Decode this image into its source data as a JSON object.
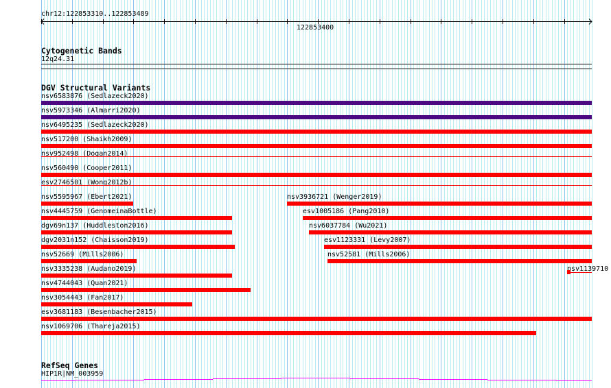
{
  "view": {
    "chrom": "chr12",
    "start": 122853310,
    "end": 122853489
  },
  "ruler": {
    "location_label": "chr12:122853310..122853489",
    "tick_label": "122853400",
    "tick_value": 122853400
  },
  "cytoband_track": {
    "title": "Cytogenetic Bands",
    "band": "12q24.31"
  },
  "dgv_track": {
    "title": "DGV Structural Variants",
    "colors": {
      "purple": "#4b0a82",
      "red": "#ff0000"
    },
    "rows": [
      [
        {
          "label": "nsv6583876 (Sedlazeck2020)",
          "start": 122853310,
          "end": 122853489,
          "color": "purple",
          "style": "thick"
        }
      ],
      [
        {
          "label": "nsv5973346 (Almarri2020)",
          "start": 122853310,
          "end": 122853489,
          "color": "purple",
          "style": "thick"
        }
      ],
      [
        {
          "label": "nsv6495235 (Sedlazeck2020)",
          "start": 122853310,
          "end": 122853489,
          "color": "red",
          "style": "thick"
        }
      ],
      [
        {
          "label": "nsv517200 (Shaikh2009)",
          "start": 122853310,
          "end": 122853489,
          "color": "red",
          "style": "thick"
        }
      ],
      [
        {
          "label": "nsv952498 (Dogan2014)",
          "start": 122853310,
          "end": 122853489,
          "color": "red",
          "style": "thin"
        }
      ],
      [
        {
          "label": "nsv560490 (Cooper2011)",
          "start": 122853310,
          "end": 122853489,
          "color": "red",
          "style": "thick"
        }
      ],
      [
        {
          "label": "esv2746501 (Wong2012b)",
          "start": 122853310,
          "end": 122853489,
          "color": "red",
          "style": "thin"
        }
      ],
      [
        {
          "label": "nsv5595967 (Ebert2021)",
          "start": 122853310,
          "end": 122853340,
          "color": "red",
          "style": "thick"
        },
        {
          "label": "nsv3936721 (Wenger2019)",
          "start": 122853390,
          "end": 122853489,
          "color": "red",
          "style": "thick"
        }
      ],
      [
        {
          "label": "nsv4445759 (GenomeinaBottle)",
          "start": 122853310,
          "end": 122853372,
          "color": "red",
          "style": "thick"
        },
        {
          "label": "esv1005186 (Pang2010)",
          "start": 122853395,
          "end": 122853489,
          "color": "red",
          "style": "thick"
        }
      ],
      [
        {
          "label": "dgv69n137 (Huddleston2016)",
          "start": 122853310,
          "end": 122853372,
          "color": "red",
          "style": "thick"
        },
        {
          "label": "nsv6037784 (Wu2021)",
          "start": 122853397,
          "end": 122853489,
          "color": "red",
          "style": "thick"
        }
      ],
      [
        {
          "label": "dgv2031n152 (Chaisson2019)",
          "start": 122853310,
          "end": 122853373,
          "color": "red",
          "style": "thick"
        },
        {
          "label": "esv1123331 (Levy2007)",
          "start": 122853402,
          "end": 122853489,
          "color": "red",
          "style": "thick"
        }
      ],
      [
        {
          "label": "nsv52669 (Mills2006)",
          "start": 122853310,
          "end": 122853341,
          "color": "red",
          "style": "thick"
        },
        {
          "label": "nsv52581 (Mills2006)",
          "start": 122853403,
          "end": 122853489,
          "color": "red",
          "style": "thick"
        }
      ],
      [
        {
          "label": "nsv3335238 (Audano2019)",
          "start": 122853310,
          "end": 122853372,
          "color": "red",
          "style": "thick"
        },
        {
          "label": "nsv1139710 (",
          "start": 122853481,
          "end": 122853489,
          "color": "red",
          "style": "box-line"
        }
      ],
      [
        {
          "label": "nsv4744043 (Quan2021)",
          "start": 122853310,
          "end": 122853378,
          "color": "red",
          "style": "thick"
        }
      ],
      [
        {
          "label": "nsv3054443 (Fan2017)",
          "start": 122853310,
          "end": 122853359,
          "color": "red",
          "style": "thick"
        }
      ],
      [
        {
          "label": "esv3681183 (Besenbacher2015)",
          "start": 122853310,
          "end": 122853489,
          "color": "red",
          "style": "thick"
        }
      ],
      [
        {
          "label": "nsv1069706 (Thareja2015)",
          "start": 122853310,
          "end": 122853471,
          "color": "red",
          "style": "thick"
        }
      ]
    ]
  },
  "refseq_track": {
    "title": "RefSeq Genes",
    "gene": "HIP1R|NM_003959",
    "color": "#ff00ff"
  },
  "grid_colors": {
    "minor": "#b4eef0",
    "major": "#88c4f0"
  }
}
